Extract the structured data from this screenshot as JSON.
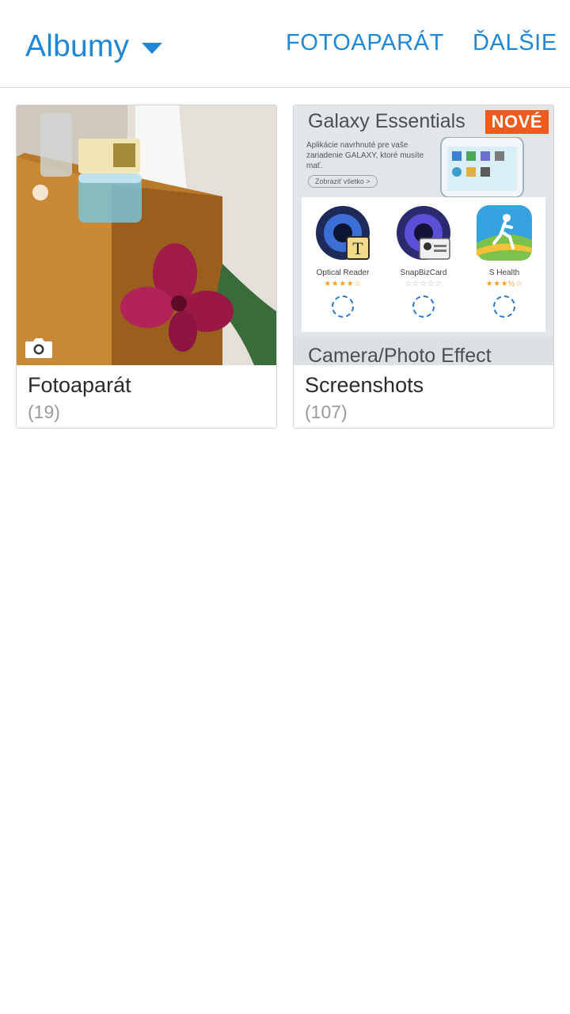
{
  "app_bar": {
    "view_title": "Albumy",
    "caret_icon": "dropdown-triangle",
    "actions": [
      "FOTOAPARÁT",
      "ĎALŠIE"
    ]
  },
  "albums": [
    {
      "name": "Fotoaparát",
      "count": "(19)",
      "overlay_icon": "camera-icon"
    },
    {
      "name": "Screenshots",
      "count": "(107)",
      "thumbnail": {
        "title": "Galaxy Essentials",
        "badge": "NOVÉ",
        "subtitle": "Aplikácie navrhnuté pre vaše zariadenie GALAXY, ktoré musíte mať.",
        "button": "Zobraziť všetko >",
        "apps": [
          {
            "name": "Optical Reader",
            "stars": "★★★★☆"
          },
          {
            "name": "SnapBizCard",
            "stars": "☆☆☆☆☆"
          },
          {
            "name": "S Health",
            "stars": "★★★½☆"
          }
        ],
        "footer": "Camera/Photo Effect"
      }
    }
  ],
  "colors": {
    "accent": "#1f87d6",
    "badge": "#ee5b1d"
  }
}
